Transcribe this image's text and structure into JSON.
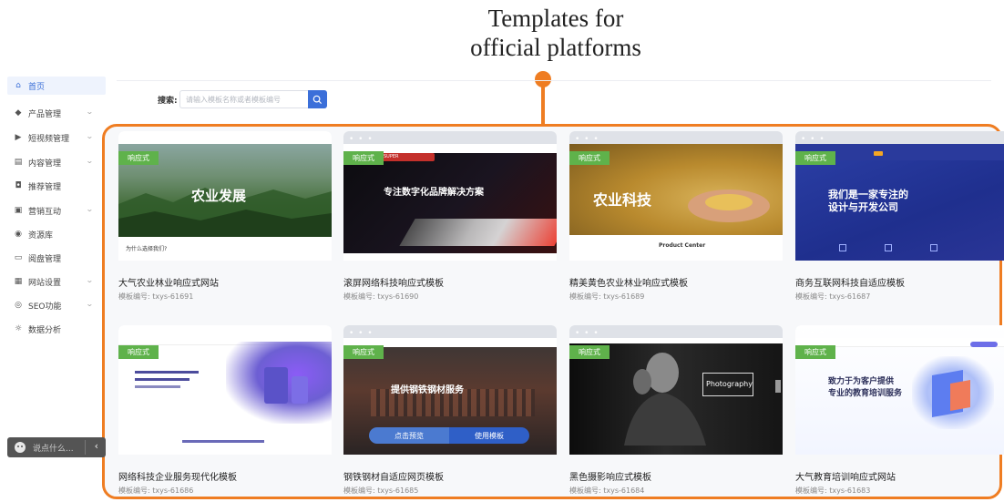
{
  "annotation": {
    "line1": "Templates for",
    "line2": "official platforms"
  },
  "sidebar": {
    "items": [
      {
        "label": "首页",
        "icon": "home-icon",
        "glyph": "⌂",
        "has_chevron": false
      },
      {
        "label": "产品管理",
        "icon": "product-icon",
        "glyph": "◆",
        "has_chevron": true
      },
      {
        "label": "短视频管理",
        "icon": "video-icon",
        "glyph": "▶",
        "has_chevron": true
      },
      {
        "label": "内容管理",
        "icon": "content-icon",
        "glyph": "▤",
        "has_chevron": true
      },
      {
        "label": "推荐管理",
        "icon": "recommend-icon",
        "glyph": "◘",
        "has_chevron": false
      },
      {
        "label": "营销互动",
        "icon": "marketing-icon",
        "glyph": "▣",
        "has_chevron": true
      },
      {
        "label": "资源库",
        "icon": "resource-icon",
        "glyph": "◉",
        "has_chevron": false
      },
      {
        "label": "阅盘管理",
        "icon": "panel-icon",
        "glyph": "▭",
        "has_chevron": false
      },
      {
        "label": "网站设置",
        "icon": "site-settings-icon",
        "glyph": "▦",
        "has_chevron": true
      },
      {
        "label": "SEO功能",
        "icon": "seo-icon",
        "glyph": "◎",
        "has_chevron": true
      },
      {
        "label": "数据分析",
        "icon": "analytics-icon",
        "glyph": "☼",
        "has_chevron": false
      }
    ],
    "chat_placeholder": "说点什么..."
  },
  "search": {
    "label": "搜索:",
    "placeholder": "请输入模板名称或者模板编号"
  },
  "colors": {
    "accent": "#3b6fd9",
    "tag": "#5fb24b",
    "frame": "#ef7d22"
  },
  "cards": [
    {
      "tag": "响应式",
      "title": "大气农业林业响应式网站",
      "code": "模板编号: txys-61691",
      "theme": "agri",
      "overlay": "农业发展"
    },
    {
      "tag": "响应式",
      "title": "滚屏网络科技响应式模板",
      "code": "模板编号: txys-61690",
      "theme": "laptop",
      "overlay": "专注数字化品牌解决方案"
    },
    {
      "tag": "响应式",
      "title": "精美黄色农业林业响应式模板",
      "code": "模板编号: txys-61689",
      "theme": "wheat",
      "overlay": "农业科技",
      "overlay2": "Product Center"
    },
    {
      "tag": "响应式",
      "title": "商务互联网科技自适应模板",
      "code": "模板编号: txys-61687",
      "theme": "tech",
      "overlay": "我们是一家专注的",
      "overlay2": "设计与开发公司"
    },
    {
      "tag": "响应式",
      "title": "网络科技企业服务现代化模板",
      "code": "模板编号: txys-61686",
      "theme": "service"
    },
    {
      "tag": "响应式",
      "title": "钢铁钢材自适应网页模板",
      "code": "模板编号: txys-61685",
      "theme": "steel",
      "overlay": "提供钢铁钢材服务",
      "btn_preview": "点击预览",
      "btn_use": "使用模板"
    },
    {
      "tag": "响应式",
      "title": "黑色摄影响应式模板",
      "code": "模板编号: txys-61684",
      "theme": "photo",
      "overlay": "Photography"
    },
    {
      "tag": "响应式",
      "title": "大气教育培训响应式网站",
      "code": "模板编号: txys-61683",
      "theme": "edu",
      "overlay": "致力于为客户提供",
      "overlay2": "专业的教育培训服务"
    }
  ]
}
